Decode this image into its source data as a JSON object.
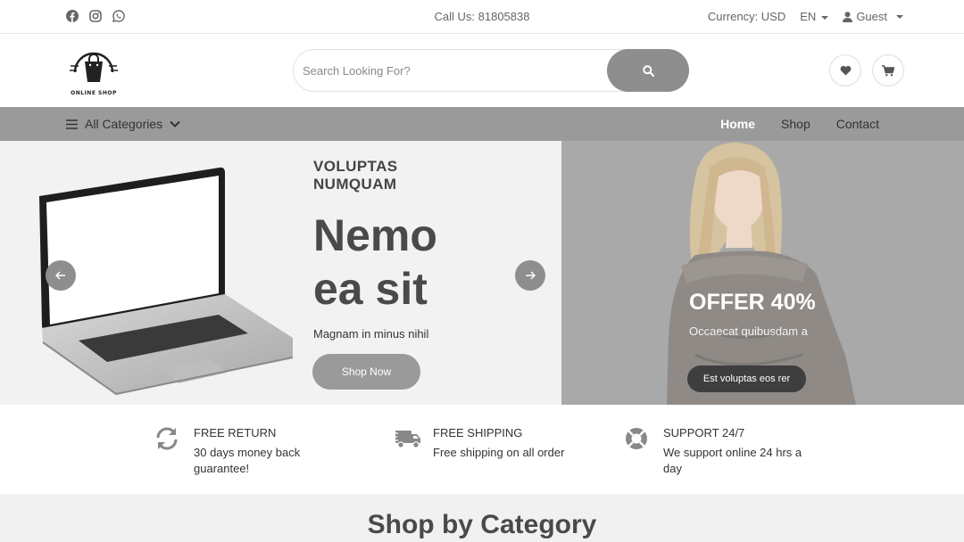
{
  "topbar": {
    "call": "Call Us: 81805838",
    "currency": "Currency: USD",
    "language": "EN",
    "user": "Guest",
    "social_icons": [
      "facebook-icon",
      "instagram-icon",
      "whatsapp-icon"
    ]
  },
  "header": {
    "logo_text": "ONLINE SHOP",
    "search_placeholder": "Search Looking For?"
  },
  "nav": {
    "all_categories": "All Categories",
    "links": [
      "Home",
      "Shop",
      "Contact"
    ],
    "active": "Home"
  },
  "hero": {
    "subtitle_line1": "VOLUPTAS",
    "subtitle_line2": "NUMQUAM",
    "title_line1": "Nemo",
    "title_line2": "ea sit",
    "description": "Magnam in minus nihil",
    "button": "Shop Now"
  },
  "offer": {
    "title": "OFFER 40%",
    "description": "Occaecat quibusdam a",
    "button": "Est voluptas eos rer"
  },
  "features": [
    {
      "title": "FREE RETURN",
      "description": "30 days money back guarantee!",
      "icon": "refresh-icon"
    },
    {
      "title": "FREE SHIPPING",
      "description": "Free shipping on all order",
      "icon": "truck-icon"
    },
    {
      "title": "SUPPORT 24/7",
      "description": "We support online 24 hrs a day",
      "icon": "lifebuoy-icon"
    }
  ],
  "section": {
    "title": "Shop by Category"
  },
  "colors": {
    "nav_bg": "#9a9a9a",
    "button_gray": "#8e8e8e",
    "dark_button": "#3e3e3e"
  }
}
